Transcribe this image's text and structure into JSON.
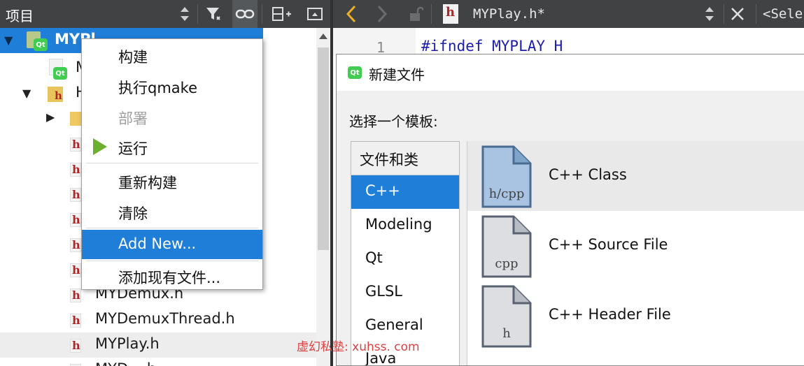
{
  "left_toolbar": {
    "title": "项目",
    "icons": [
      "updown-icon",
      "filter-icon",
      "link-icon",
      "split-add-icon",
      "expand-icon"
    ]
  },
  "right_toolbar": {
    "file_name": "MYPlay.h*",
    "symbol_placeholder": "<Selec"
  },
  "tree": {
    "root_label": "MYPl",
    "rows": [
      {
        "label": "M"
      },
      {
        "label": "H"
      },
      {
        "label": "MYDemux.h"
      },
      {
        "label": "MYDemuxThread.h"
      },
      {
        "label": "MYPlay.h"
      },
      {
        "label": "MYD....h"
      }
    ]
  },
  "context_menu": {
    "items": [
      {
        "label": "构建"
      },
      {
        "label": "执行qmake"
      },
      {
        "label": "部署"
      },
      {
        "label": "运行"
      },
      {
        "label": "重新构建"
      },
      {
        "label": "清除"
      },
      {
        "label": "Add New..."
      },
      {
        "label": "添加现有文件..."
      }
    ]
  },
  "editor": {
    "line_number": "1",
    "code_line": "#ifndef MYPLAY_H"
  },
  "dialog": {
    "title": "新建文件",
    "logo": "Qt",
    "prompt": "选择一个模板:",
    "category_header": "文件和类",
    "categories": [
      "C++",
      "Modeling",
      "Qt",
      "GLSL",
      "General",
      "Java"
    ],
    "templates": [
      {
        "name": "C++ Class",
        "icon_label": "h/cpp"
      },
      {
        "name": "C++ Source File",
        "icon_label": "cpp"
      },
      {
        "name": "C++ Header File",
        "icon_label": "h"
      }
    ]
  },
  "watermark": "虚幻私塾: xuhss. com",
  "colors": {
    "toolbar_bg": "#404244",
    "selection": "#1e7ed8",
    "run_green": "#6ab02e",
    "qt_green": "#41cd52",
    "header_icon_red": "#b02525",
    "code_blue": "#1c1cb0",
    "watermark_red": "#e04040"
  }
}
